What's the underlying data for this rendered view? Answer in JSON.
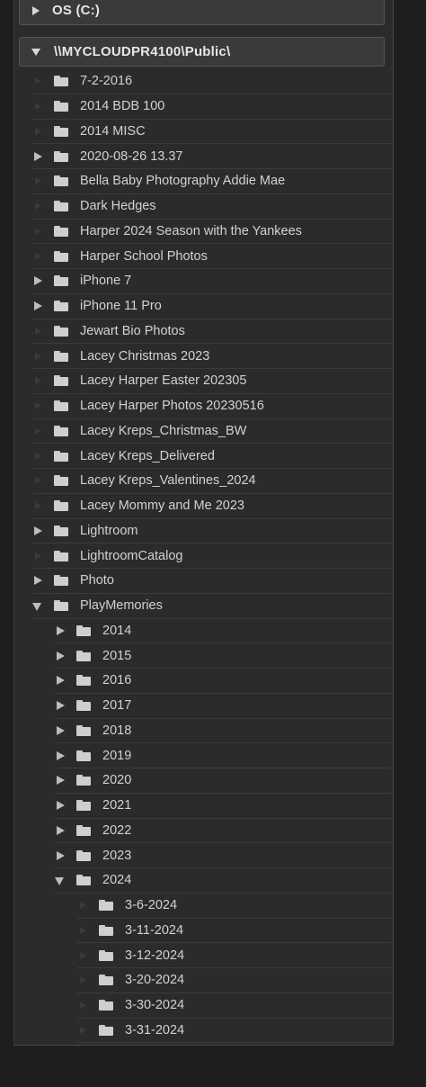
{
  "volumes": [
    {
      "label": "OS (C:)",
      "state": "collapsed"
    },
    {
      "label": "\\\\MYCLOUDPR4100\\Public\\",
      "state": "expanded"
    }
  ],
  "folders": [
    {
      "label": "7-2-2016",
      "level": 0,
      "toggle": "none"
    },
    {
      "label": "2014 BDB 100",
      "level": 0,
      "toggle": "none"
    },
    {
      "label": "2014 MISC",
      "level": 0,
      "toggle": "none"
    },
    {
      "label": "2020-08-26 13.37",
      "level": 0,
      "toggle": "collapsed"
    },
    {
      "label": "Bella Baby Photography Addie Mae",
      "level": 0,
      "toggle": "none"
    },
    {
      "label": "Dark Hedges",
      "level": 0,
      "toggle": "none"
    },
    {
      "label": "Harper 2024 Season with the Yankees",
      "level": 0,
      "toggle": "none"
    },
    {
      "label": "Harper School Photos",
      "level": 0,
      "toggle": "none"
    },
    {
      "label": "iPhone 7",
      "level": 0,
      "toggle": "collapsed"
    },
    {
      "label": "iPhone 11 Pro",
      "level": 0,
      "toggle": "collapsed"
    },
    {
      "label": "Jewart Bio Photos",
      "level": 0,
      "toggle": "none"
    },
    {
      "label": "Lacey Christmas 2023",
      "level": 0,
      "toggle": "none"
    },
    {
      "label": "Lacey Harper Easter 202305",
      "level": 0,
      "toggle": "none"
    },
    {
      "label": "Lacey Harper Photos 20230516",
      "level": 0,
      "toggle": "none"
    },
    {
      "label": "Lacey Kreps_Christmas_BW",
      "level": 0,
      "toggle": "none"
    },
    {
      "label": "Lacey Kreps_Delivered",
      "level": 0,
      "toggle": "none"
    },
    {
      "label": "Lacey Kreps_Valentines_2024",
      "level": 0,
      "toggle": "none"
    },
    {
      "label": "Lacey Mommy and Me 2023",
      "level": 0,
      "toggle": "none"
    },
    {
      "label": "Lightroom",
      "level": 0,
      "toggle": "collapsed"
    },
    {
      "label": "LightroomCatalog",
      "level": 0,
      "toggle": "none"
    },
    {
      "label": "Photo",
      "level": 0,
      "toggle": "collapsed"
    },
    {
      "label": "PlayMemories",
      "level": 0,
      "toggle": "expanded"
    },
    {
      "label": "2014",
      "level": 1,
      "toggle": "collapsed"
    },
    {
      "label": "2015",
      "level": 1,
      "toggle": "collapsed"
    },
    {
      "label": "2016",
      "level": 1,
      "toggle": "collapsed"
    },
    {
      "label": "2017",
      "level": 1,
      "toggle": "collapsed"
    },
    {
      "label": "2018",
      "level": 1,
      "toggle": "collapsed"
    },
    {
      "label": "2019",
      "level": 1,
      "toggle": "collapsed"
    },
    {
      "label": "2020",
      "level": 1,
      "toggle": "collapsed"
    },
    {
      "label": "2021",
      "level": 1,
      "toggle": "collapsed"
    },
    {
      "label": "2022",
      "level": 1,
      "toggle": "collapsed"
    },
    {
      "label": "2023",
      "level": 1,
      "toggle": "collapsed"
    },
    {
      "label": "2024",
      "level": 1,
      "toggle": "expanded"
    },
    {
      "label": "3-6-2024",
      "level": 2,
      "toggle": "none"
    },
    {
      "label": "3-11-2024",
      "level": 2,
      "toggle": "none"
    },
    {
      "label": "3-12-2024",
      "level": 2,
      "toggle": "none"
    },
    {
      "label": "3-20-2024",
      "level": 2,
      "toggle": "none"
    },
    {
      "label": "3-30-2024",
      "level": 2,
      "toggle": "none"
    },
    {
      "label": "3-31-2024",
      "level": 2,
      "toggle": "none"
    }
  ],
  "colors": {
    "panel_bg": "#2b2b2b",
    "text": "#d2d2d2",
    "row_divider": "#3b3b3b",
    "folder_icon": "#cfcfcf"
  }
}
